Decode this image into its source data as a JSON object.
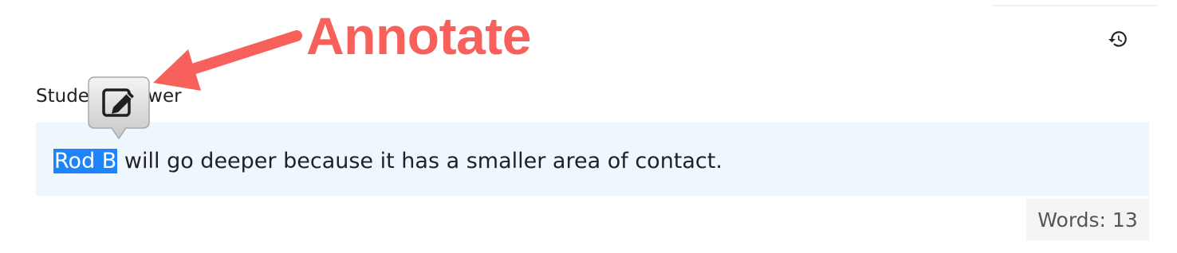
{
  "annotation_callout": {
    "text": "Annotate",
    "color": "#f7605b"
  },
  "toolbar": {
    "history_icon": "history-icon"
  },
  "answer": {
    "label": "Student Answer",
    "selected_text": "Rod B",
    "remaining_text": " will go deeper because it has a smaller area of contact.",
    "highlight_color": "#1f84fb",
    "background_color": "#eef6fe"
  },
  "annotate_popup": {
    "icon": "edit-note-icon"
  },
  "footer": {
    "word_count": "Words: 13"
  }
}
